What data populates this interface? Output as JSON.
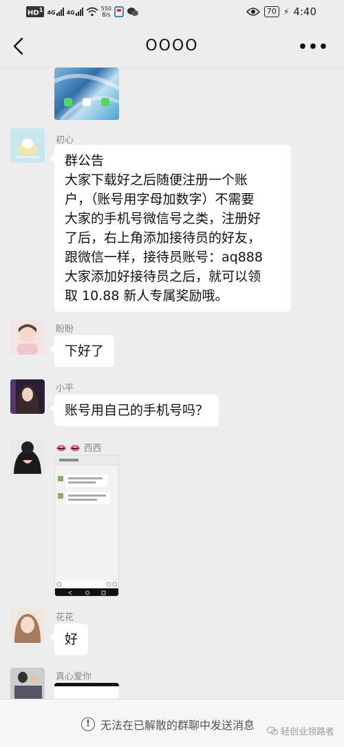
{
  "status_bar": {
    "hd_tag": "HD",
    "hd_sub": "1",
    "sig1_label": "4G",
    "sig2_label": "4G",
    "net_speed_value": "550",
    "net_speed_unit": "B/s",
    "battery": "70",
    "time": "4:40"
  },
  "nav": {
    "title": "OOOO",
    "more": "•••"
  },
  "messages": [
    {
      "sender": "初心",
      "lines": [
        "群公告",
        "大家下载好之后随便注册一个账",
        "户，（账号用字母加数字）不需要",
        "大家的手机号微信号之类，注册好",
        "了后，右上角添加接待员的好友，",
        "跟微信一样，接待员账号：aq888",
        "大家添加好接待员之后，就可以领",
        "取 10.88 新人专属奖励哦。"
      ]
    },
    {
      "sender": "盼盼",
      "text": "下好了"
    },
    {
      "sender": "小平",
      "text": "账号用自己的手机号吗？"
    },
    {
      "sender": "西西",
      "sender_prefix": "👄 👄 "
    },
    {
      "sender": "花花",
      "text": "好"
    },
    {
      "sender": "真心爱你"
    }
  ],
  "footer": {
    "notice": "无法在已解散的群聊中发送消息",
    "watermark": "轻创业领路者"
  }
}
